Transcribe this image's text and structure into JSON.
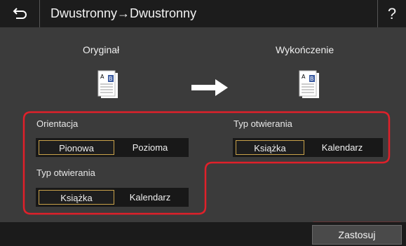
{
  "header": {
    "title": "Dwustronny→Dwustronny",
    "help_label": "?"
  },
  "preview": {
    "original_label": "Oryginał",
    "finish_label": "Wykończenie",
    "doc_page_a": "A",
    "doc_page_b": "B"
  },
  "orientation": {
    "label": "Orientacja",
    "options": [
      "Pionowa",
      "Pozioma"
    ],
    "selected": "Pionowa"
  },
  "opening_type_left": {
    "label": "Typ otwierania",
    "options": [
      "Książka",
      "Kalendarz"
    ],
    "selected": "Książka"
  },
  "opening_type_right": {
    "label": "Typ otwierania",
    "options": [
      "Książka",
      "Kalendarz"
    ],
    "selected": "Książka"
  },
  "footer": {
    "apply_label": "Zastosuj"
  },
  "colors": {
    "highlight": "#e0202a",
    "selected_border": "#c9a24a",
    "background": "#3b3b3b"
  }
}
